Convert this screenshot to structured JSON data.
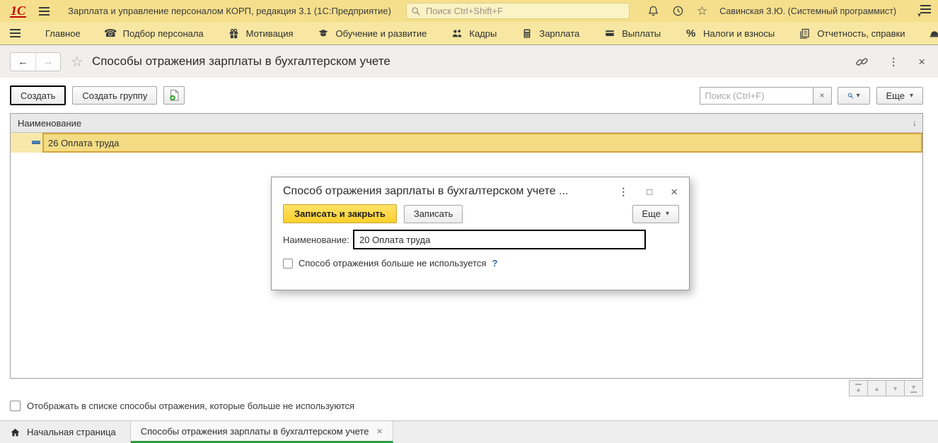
{
  "colors": {
    "topbar_bg": "#f5df8c",
    "menubar_bg": "#f7e7a2",
    "selected_row_bg": "#f3dc84",
    "selected_row_border": "#d8a33c",
    "primary_button_yellow": "#fdd02b",
    "active_tab_underline": "#2f9a41",
    "link_blue": "#2e6da4",
    "logo_red": "#c40000"
  },
  "icons": {
    "close": "×",
    "more_vert": "⋮",
    "maximize": "□",
    "back": "←",
    "forward": "→",
    "star": "☆",
    "caret_down": "▾",
    "sort_down": "↓",
    "up": "▲",
    "down": "▼",
    "percent": "%",
    "phone": "☎",
    "overflow_right": "▶"
  },
  "top_bar": {
    "logo_text": "1С",
    "title": "Зарплата и управление персоналом КОРП, редакция 3.1 (1С:Предприятие)",
    "search_placeholder": "Поиск Ctrl+Shift+F",
    "user_name": "Савинская З.Ю. (Системный программист)"
  },
  "menu_bar": {
    "items": [
      {
        "label": "Главное",
        "icon": "none"
      },
      {
        "label": "Подбор персонала",
        "icon": "phone-icon"
      },
      {
        "label": "Мотивация",
        "icon": "gift-icon"
      },
      {
        "label": "Обучение и развитие",
        "icon": "graduation-icon"
      },
      {
        "label": "Кадры",
        "icon": "people-icon"
      },
      {
        "label": "Зарплата",
        "icon": "calculator-icon"
      },
      {
        "label": "Выплаты",
        "icon": "card-icon"
      },
      {
        "label": "Налоги и взносы",
        "icon": "percent-icon"
      },
      {
        "label": "Отчетность, справки",
        "icon": "report-icon"
      }
    ]
  },
  "page": {
    "title": "Способы отражения зарплаты в бухгалтерском учете",
    "toolbar": {
      "create_label": "Создать",
      "create_group_label": "Создать группу",
      "search_placeholder": "Поиск (Ctrl+F)",
      "more_label": "Еще"
    },
    "table": {
      "header": "Наименование",
      "rows": [
        {
          "name": "26 Оплата труда"
        }
      ]
    },
    "footer_checkbox": "Отображать в списке способы отражения, которые больше не используются"
  },
  "dialog": {
    "title": "Способ отражения зарплаты в бухгалтерском учете ...",
    "save_close_label": "Записать и закрыть",
    "save_label": "Записать",
    "more_label": "Еще",
    "name_label": "Наименование:",
    "name_value": "20 Оплата труда",
    "checkbox_label": "Способ отражения больше не используется",
    "help_mark": "?"
  },
  "taskbar": {
    "home_label": "Начальная страница",
    "tabs": [
      {
        "label": "Способы отражения зарплаты в бухгалтерском учете",
        "active": true
      }
    ]
  }
}
